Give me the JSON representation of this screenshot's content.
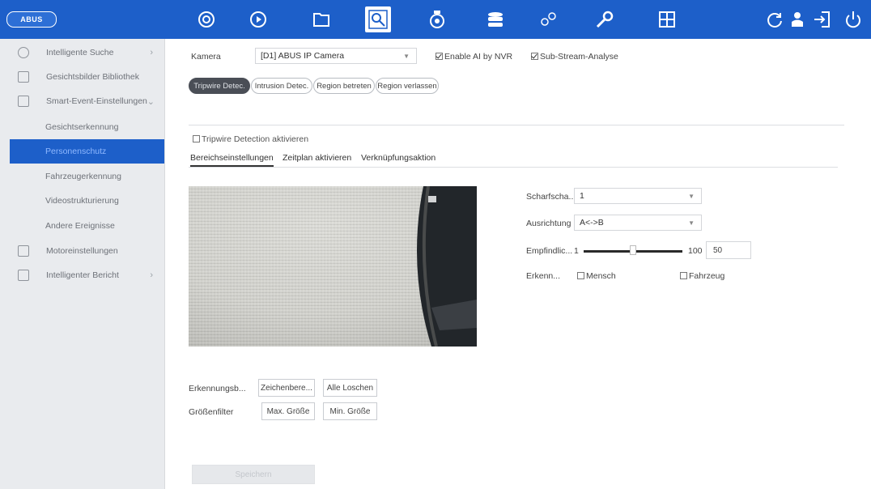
{
  "colors": {
    "topbar": "#1d5fc9",
    "sidebar_bg": "#e9ebee",
    "selected": "#1d5fc9",
    "active_pill": "#4a4e56"
  },
  "topbar": {
    "logo": "ABUS",
    "icons": [
      "live-view-icon",
      "playback-icon",
      "files-icon",
      "smart-search-icon",
      "camera-config-icon",
      "storage-icon",
      "system-settings-icon",
      "maintenance-icon",
      "layout-icon",
      "refresh-icon",
      "user-icon",
      "logout-icon",
      "power-icon"
    ],
    "active_icon": "smart-search-icon"
  },
  "sidebar": {
    "items": [
      {
        "label": "Intelligente Suche",
        "icon": "search-icon",
        "arrow": "›"
      },
      {
        "label": "Gesichtsbilder Bibliothek",
        "icon": "face-library-icon"
      },
      {
        "label": "Smart-Event-Einstellungen",
        "icon": "event-settings-icon",
        "arrow": "⌄"
      },
      {
        "label": "Gesichtserkennung"
      },
      {
        "label": "Personenschutz"
      },
      {
        "label": "Fahrzeugerkennung"
      },
      {
        "label": "Videostrukturierung"
      },
      {
        "label": "Andere Ereignisse"
      },
      {
        "label": "Motoreinstellungen",
        "icon": "motion-icon"
      },
      {
        "label": "Intelligenter Bericht",
        "icon": "report-icon",
        "arrow": "›"
      }
    ]
  },
  "main": {
    "camera_label": "Kamera",
    "camera_value": "[D1] ABUS IP Camera",
    "enable_ai": "Enable AI by NVR",
    "sub_stream": "Sub-Stream-Analyse",
    "pills": [
      "Tripwire Detec.",
      "Intrusion Detec.",
      "Region betreten",
      "Region verlassen"
    ],
    "tripwire_enable": "Tripwire Detection aktivieren",
    "tabs": [
      "Bereichseinstellungen",
      "Zeitplan aktivieren",
      "Verknüpfungsaktion"
    ],
    "form": {
      "schaerfe_label": "Scharfscha...",
      "schaerfe_value": "1",
      "richtung_label": "Ausrichtung",
      "richtung_value": "A<->B",
      "empf_label": "Empfindlic...",
      "empf_min": "1",
      "empf_max": "100",
      "empf_value": "50",
      "empf_level": 0.5,
      "erkenn_label": "Erkenn...",
      "mensch": "Mensch",
      "fahrzeug": "Fahrzeug"
    },
    "erkennung_label": "Erkennungsb...",
    "zeichen_btn": "Zeichenbere...",
    "alle_btn": "Alle Loschen",
    "groessen_label": "Größenfilter",
    "max_btn": "Max. Größe",
    "min_btn": "Min. Größe",
    "save_btn": "Speichern"
  }
}
